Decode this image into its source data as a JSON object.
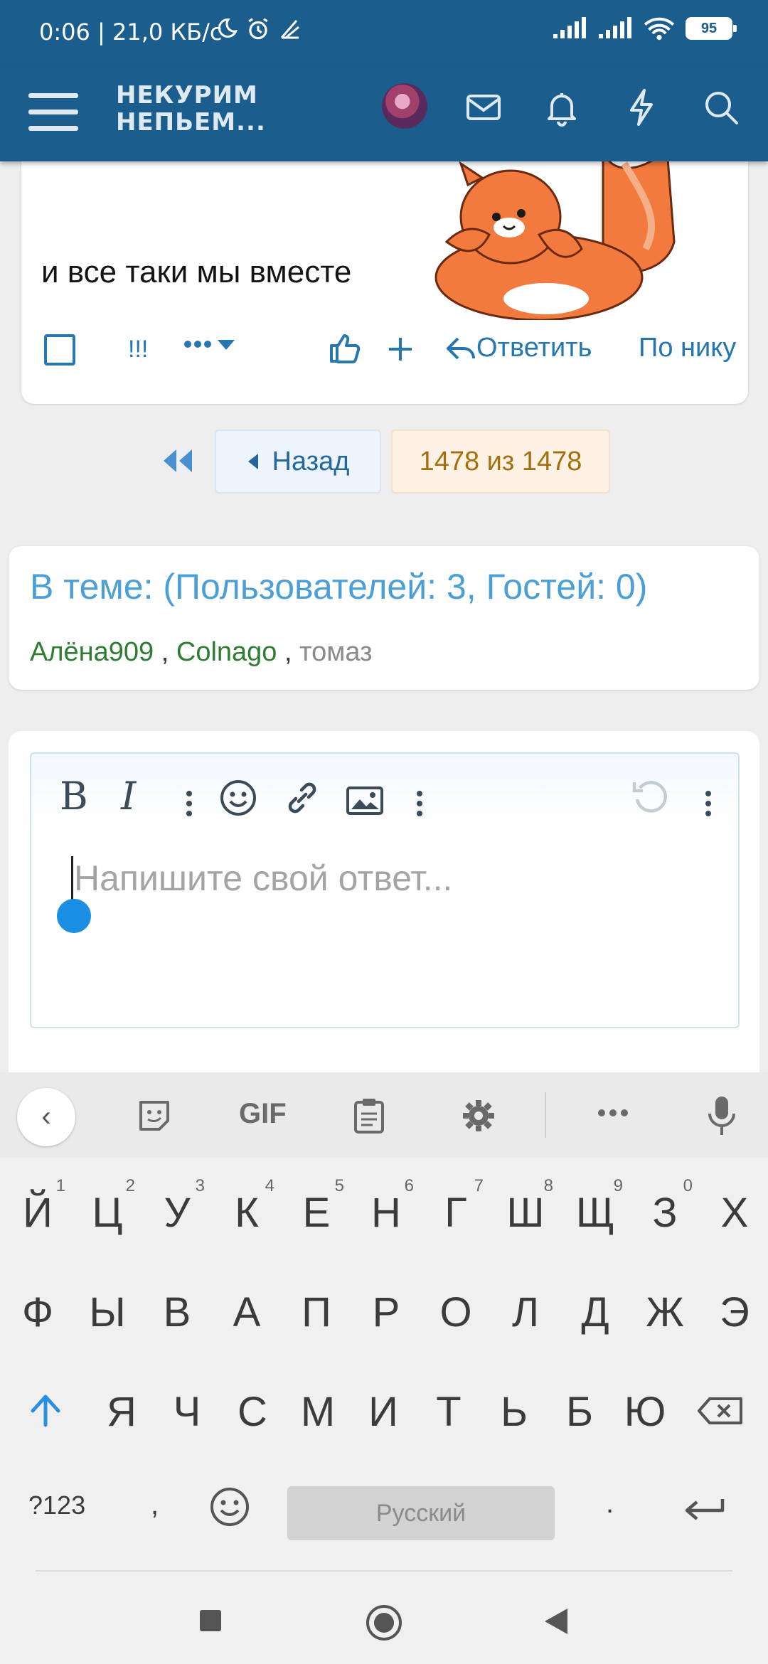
{
  "status_bar": {
    "time": "0:06 | 21,0 КБ/с",
    "battery": "95"
  },
  "header": {
    "logo_line1": "НЕКУРИМ",
    "logo_line2": "НЕПЬЕМ..."
  },
  "post": {
    "text": "и все таки мы вместе",
    "action_mark": "!!!",
    "reply_label": "Ответить",
    "by_nick_label": "По нику"
  },
  "pagination": {
    "back_label": "Назад",
    "page_status": "1478 из 1478"
  },
  "online": {
    "title": "В теме: (Пользователей: 3, Гостей: 0)",
    "users": [
      "Алёна909",
      "Colnago",
      "томаз"
    ],
    "separator": ","
  },
  "editor": {
    "bold_label": "B",
    "italic_label": "I",
    "placeholder": "Напишите свой ответ..."
  },
  "keyboard": {
    "gif_label": "GIF",
    "row1": [
      "Й",
      "Ц",
      "У",
      "К",
      "Е",
      "Н",
      "Г",
      "Ш",
      "Щ",
      "З",
      "Х"
    ],
    "row1_hints": [
      "1",
      "2",
      "3",
      "4",
      "5",
      "6",
      "7",
      "8",
      "9",
      "0",
      ""
    ],
    "row2": [
      "Ф",
      "Ы",
      "В",
      "А",
      "П",
      "Р",
      "О",
      "Л",
      "Д",
      "Ж",
      "Э"
    ],
    "row3": [
      "Я",
      "Ч",
      "С",
      "М",
      "И",
      "Т",
      "Ь",
      "Б",
      "Ю"
    ],
    "numbers_key": "?123",
    "comma_key": ",",
    "space_label": "Русский",
    "period_key": "."
  },
  "colors": {
    "header_bg": "#1b5d8d",
    "link_blue": "#2577b1",
    "member_green": "#2e7d32",
    "page_status_text": "#a56f10"
  }
}
